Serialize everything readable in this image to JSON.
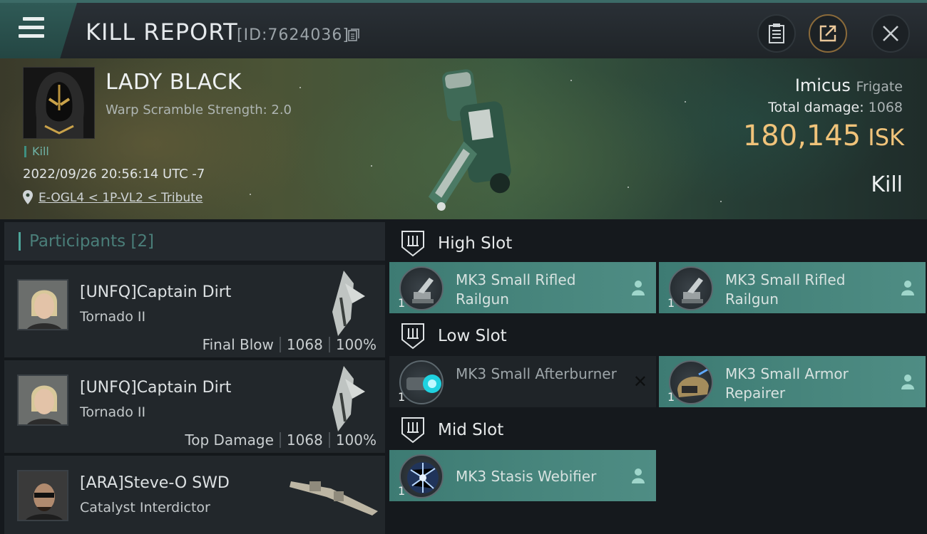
{
  "header": {
    "title": "KILL REPORT",
    "report_id": "[ID:7624036]"
  },
  "victim": {
    "name": "LADY BLACK",
    "warp_scramble": "Warp Scramble Strength: 2.0",
    "kill_tag": "Kill",
    "datetime": "2022/09/26 20:56:14 UTC -7",
    "location": "E-OGL4 < 1P-VL2 < Tribute"
  },
  "ship": {
    "name": "Imicus",
    "class": "Frigate",
    "total_damage_label": "Total damage:",
    "total_damage": "1068",
    "isk_value": "180,145",
    "isk_unit": "ISK",
    "result": "Kill"
  },
  "participants": {
    "title": "Participants",
    "count": "[2]",
    "list": [
      {
        "name": "[UNFQ]Captain Dirt",
        "ship": "Tornado II",
        "role": "Final Blow",
        "damage": "1068",
        "percent": "100%"
      },
      {
        "name": "[UNFQ]Captain Dirt",
        "ship": "Tornado II",
        "role": "Top Damage",
        "damage": "1068",
        "percent": "100%"
      },
      {
        "name": "[ARA]Steve-O SWD",
        "ship": "Catalyst Interdictor"
      }
    ]
  },
  "slots": {
    "high": {
      "label": "High Slot",
      "modules": [
        {
          "qty": "1",
          "name": "MK3 Small Rifled Railgun"
        },
        {
          "qty": "1",
          "name": "MK3 Small Rifled Railgun"
        }
      ]
    },
    "low": {
      "label": "Low Slot",
      "modules": [
        {
          "qty": "1",
          "name": "MK3 Small Afterburner",
          "destroyed_mark": "✕"
        },
        {
          "qty": "1",
          "name": "MK3 Small Armor Repairer"
        }
      ]
    },
    "mid": {
      "label": "Mid Slot",
      "modules": [
        {
          "qty": "1",
          "name": "MK3 Stasis Webifier"
        }
      ]
    }
  },
  "colors": {
    "accent_teal": "#4f8d84",
    "isk_gold": "#f0c37a"
  }
}
